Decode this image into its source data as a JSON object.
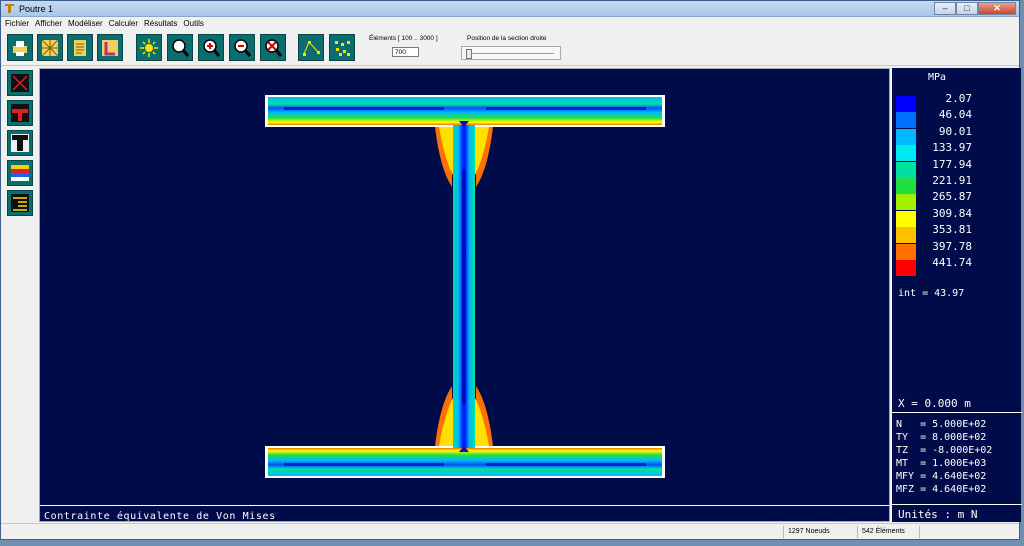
{
  "window": {
    "title": "Poutre 1"
  },
  "menu": [
    "Fichier",
    "Afficher",
    "Modéliser",
    "Calculer",
    "Résultats",
    "Outils"
  ],
  "toolbar": {
    "elements_label": "Éléments  [ 100 .. 3000 ]",
    "elements_value": "700",
    "position_label": "Position de la section droite",
    "position_slider": 0.0,
    "icons": [
      "print-icon",
      "mesh-icon",
      "notes-icon",
      "section-icon",
      "light-icon",
      "zoom-icon",
      "zoom-in-icon",
      "zoom-out-icon",
      "zoom-cancel-icon",
      "polyline-icon",
      "nodes-icon"
    ]
  },
  "left_tools": [
    "contour-tool-icon",
    "flange-tool-icon",
    "t-section-tool-icon",
    "color-map-tool-icon",
    "hatch-tool-icon"
  ],
  "plot": {
    "caption": "Contrainte équivalente de Von Mises"
  },
  "legend": {
    "unit": "MPa",
    "levels": [
      "2.07",
      "46.04",
      "90.01",
      "133.97",
      "177.94",
      "221.91",
      "265.87",
      "309.84",
      "353.81",
      "397.78",
      "441.74"
    ],
    "colors": [
      "#0000ff",
      "#0070ff",
      "#00b8ff",
      "#00e8f0",
      "#00e0a0",
      "#20e040",
      "#a0f000",
      "#ffff00",
      "#ffc000",
      "#ff7000",
      "#ff0000"
    ],
    "interval": "int = 43.97",
    "x_position": "X = 0.000 m"
  },
  "forces": [
    "N   = 5.000E+02",
    "TY  = 8.000E+02",
    "TZ  = -8.000E+02",
    "MT  = 1.000E+03",
    "MFY = 4.640E+02",
    "MFZ = 4.640E+02"
  ],
  "units_text": "Unités :  m N",
  "status": {
    "nodes": "1297 Noeuds",
    "elements": "542 Éléments"
  }
}
